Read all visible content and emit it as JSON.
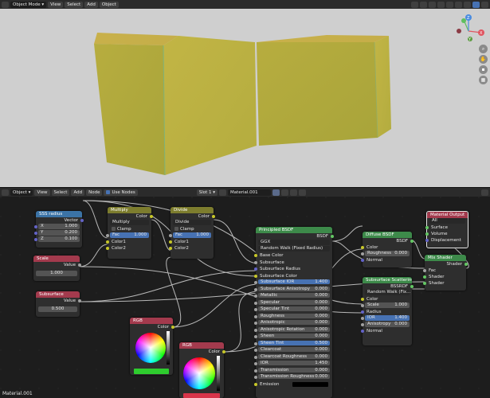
{
  "viewport_header": {
    "mode": "Object Mode",
    "menus": [
      "View",
      "Select",
      "Add",
      "Object"
    ]
  },
  "node_header": {
    "type": "Object",
    "menus": [
      "View",
      "Select",
      "Add",
      "Node"
    ],
    "use_nodes": "Use Nodes",
    "slot": "Slot 1",
    "material": "Material.001"
  },
  "footer_label": "Material.001",
  "gizmo": {
    "x": "X",
    "y": "Y",
    "z": "Z"
  },
  "nodes": {
    "sss_radius": {
      "title": "SSS radius",
      "output": "Vector",
      "fields": [
        {
          "label": "X",
          "value": "1.000"
        },
        {
          "label": "Y",
          "value": "0.200"
        },
        {
          "label": "Z",
          "value": "0.100"
        }
      ]
    },
    "scale": {
      "title": "Scale",
      "output": "Value",
      "value": "1.000"
    },
    "subsurface": {
      "title": "Subsurface",
      "output": "Value",
      "value": "0.500"
    },
    "multiply": {
      "title": "Multiply",
      "output": "Color",
      "op": "Multiply",
      "clamp": "Clamp",
      "fac_label": "Fac",
      "fac_value": "1.000",
      "in1": "Color1",
      "in2": "Color2"
    },
    "divide": {
      "title": "Divide",
      "output": "Color",
      "op": "Divide",
      "clamp": "Clamp",
      "fac_label": "Fac",
      "fac_value": "1.000",
      "in1": "Color1",
      "in2": "Color2"
    },
    "rgb1": {
      "title": "RGB",
      "output": "Color"
    },
    "rgb2": {
      "title": "RGB",
      "output": "Color"
    },
    "principled": {
      "title": "Principled BSDF",
      "output": "BSDF",
      "distribution": "GGX",
      "subsurface_method": "Random Walk (Fixed Radius)",
      "inputs": [
        {
          "label": "Base Color",
          "value": ""
        },
        {
          "label": "Subsurface",
          "value": ""
        },
        {
          "label": "Subsurface Radius",
          "value": ""
        },
        {
          "label": "Subsurface Color",
          "value": ""
        },
        {
          "label": "Subsurface IOR",
          "value": "1.400"
        },
        {
          "label": "Subsurface Anisotropy",
          "value": "0.000"
        },
        {
          "label": "Metallic",
          "value": "0.000"
        },
        {
          "label": "Specular",
          "value": "0.000"
        },
        {
          "label": "Specular Tint",
          "value": "0.000"
        },
        {
          "label": "Roughness",
          "value": "0.000"
        },
        {
          "label": "Anisotropic",
          "value": "0.000"
        },
        {
          "label": "Anisotropic Rotation",
          "value": "0.000"
        },
        {
          "label": "Sheen",
          "value": "0.000"
        },
        {
          "label": "Sheen Tint",
          "value": "0.500"
        },
        {
          "label": "Clearcoat",
          "value": "0.000"
        },
        {
          "label": "Clearcoat Roughness",
          "value": "0.000"
        },
        {
          "label": "IOR",
          "value": "1.450"
        },
        {
          "label": "Transmission",
          "value": "0.000"
        },
        {
          "label": "Transmission Roughness",
          "value": "0.000"
        },
        {
          "label": "Emission",
          "value": ""
        }
      ]
    },
    "diffuse": {
      "title": "Diffuse BSDF",
      "output": "BSDF",
      "inputs": [
        {
          "label": "Color",
          "value": ""
        },
        {
          "label": "Roughness",
          "value": "0.000"
        },
        {
          "label": "Normal",
          "value": ""
        }
      ]
    },
    "sss": {
      "title": "Subsurface Scattering",
      "output": "BSSRDF",
      "method": "Random Walk (Fix...",
      "inputs": [
        {
          "label": "Color",
          "value": ""
        },
        {
          "label": "Scale",
          "value": "1.000"
        },
        {
          "label": "Radius",
          "value": ""
        },
        {
          "label": "IOR",
          "value": "1.400"
        },
        {
          "label": "Anisotropy",
          "value": "0.000"
        },
        {
          "label": "Normal",
          "value": ""
        }
      ]
    },
    "mix": {
      "title": "Mix Shader",
      "output": "Shader",
      "inputs": [
        "Fac",
        "Shader",
        "Shader"
      ]
    },
    "output": {
      "title": "Material Output",
      "target": "All",
      "inputs": [
        "Surface",
        "Volume",
        "Displacement"
      ]
    }
  }
}
